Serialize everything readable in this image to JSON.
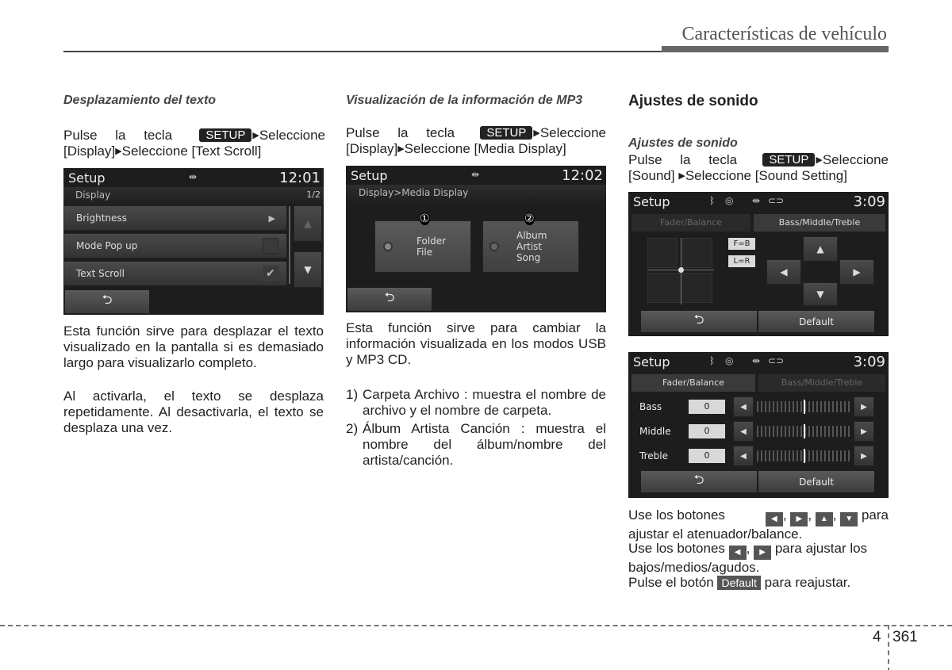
{
  "header": {
    "title": "Características de vehículo"
  },
  "col1": {
    "subhead": "Desplazamiento del texto",
    "instr_pre": "Pulse la tecla",
    "key": "SETUP",
    "instr_1": "Seleccione",
    "instr_2a": "[Display]",
    "instr_2b": "Seleccione [Text Scroll]",
    "screen": {
      "title": "Setup",
      "usb_icon": "usb-icon",
      "time": "12:01",
      "section": "Display",
      "page": "1/2",
      "items": [
        {
          "label": "Brightness",
          "control": "arrow-right"
        },
        {
          "label": "Mode Pop up",
          "control": "checkbox-unchecked"
        },
        {
          "label": "Text Scroll",
          "control": "checkbox-checked"
        }
      ],
      "back": "⮌"
    },
    "para1": "Esta función sirve para desplazar el texto visualizado en la pantalla si es demasiado largo para visualizarlo completo.",
    "para2": "Al activarla, el texto se desplaza repetidamente. Al desactivarla, el texto se desplaza una vez."
  },
  "col2": {
    "subhead": "Visualización de la información de MP3",
    "instr_pre": "Pulse la tecla",
    "key": "SETUP",
    "instr_1": "Seleccione",
    "instr_2a": "[Display]",
    "instr_2b": "Seleccione [Media Display]",
    "screen": {
      "title": "Setup",
      "time": "12:02",
      "breadcrumb": "Display>Media Display",
      "options": [
        {
          "marker": "①",
          "lines": [
            "Folder",
            "File"
          ]
        },
        {
          "marker": "②",
          "lines": [
            "Album",
            "Artist",
            "Song"
          ]
        }
      ],
      "back": "⮌"
    },
    "para1": "Esta función sirve para cambiar la información visualizada en los modos USB y MP3 CD.",
    "list": [
      {
        "num": "1)",
        "text": "Carpeta Archivo : muestra el nombre de archivo y el nombre de carpeta."
      },
      {
        "num": "2)",
        "text": "Álbum Artista Canción : muestra el nombre del álbum/nombre del artista/canción."
      }
    ]
  },
  "col3": {
    "heading": "Ajustes de sonido",
    "subhead": "Ajustes de sonido",
    "instr_pre": "Pulse la tecla",
    "key": "SETUP",
    "instr_1": "Seleccione",
    "instr_2a": "[Sound]",
    "instr_2b": "Seleccione [Sound Setting]",
    "screen1": {
      "title": "Setup",
      "time": "3:09",
      "tab_active": "Fader/Balance",
      "tab_inactive": "Bass/Middle/Treble",
      "fb_label": "F=B",
      "lr_label": "L=R",
      "default": "Default",
      "back": "⮌"
    },
    "screen2": {
      "title": "Setup",
      "time": "3:09",
      "tab_inactive": "Fader/Balance",
      "tab_active": "Bass/Middle/Treble",
      "rows": [
        {
          "label": "Bass",
          "value": "0",
          "level": 0
        },
        {
          "label": "Middle",
          "value": "0",
          "level": 0
        },
        {
          "label": "Treble",
          "value": "0",
          "level": 0
        }
      ],
      "default": "Default",
      "back": "⮌"
    },
    "text1a": "Use los botones",
    "text1b": "para ajustar el atenuador/balance.",
    "text2a": "Use los botones",
    "text2b": "para ajustar los bajos/medios/agudos.",
    "text3a": "Pulse el botón",
    "default_key": "Default",
    "text3b": "para reajustar."
  },
  "footer": {
    "chapter": "4",
    "page": "361"
  }
}
